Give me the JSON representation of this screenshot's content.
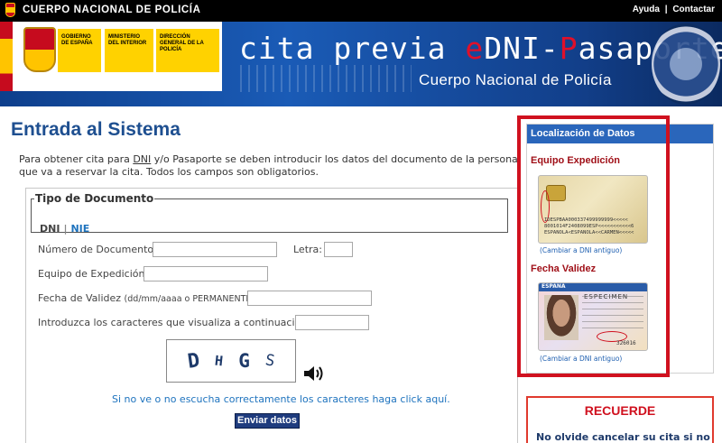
{
  "topbar": {
    "brand": "CUERPO NACIONAL DE POLICÍA",
    "links": [
      "Ayuda",
      "Contactar"
    ],
    "separator": "|"
  },
  "banner": {
    "gov_blocks": [
      "GOBIERNO DE ESPAÑA",
      "MINISTERIO DEL INTERIOR",
      "DIRECCIÓN GENERAL DE LA POLICÍA"
    ],
    "title_part1": "cita previa ",
    "title_e": "e",
    "title_dni": "DNI-",
    "title_p": "P",
    "title_rest": "asaporte",
    "subtitle": "Cuerpo Nacional de Policía"
  },
  "main": {
    "title": "Entrada al Sistema",
    "intro_1": "Para obtener cita para ",
    "intro_dni": "DNI",
    "intro_2": " y/o Pasaporte se deben introducir los datos del documento de la persona que va a reservar la cita. Todos los campos son obligatorios."
  },
  "form": {
    "doc_type_legend": "Tipo de Documento",
    "doc_type_options": [
      "DNI",
      "NIE"
    ],
    "doc_type_sep": "|",
    "doc_number_label": "Número de Documento:",
    "letter_label": "Letra:",
    "team_label": "Equipo de Expedición:",
    "validity_label": "Fecha de Validez",
    "validity_hint": "(dd/mm/aaaa o PERMANENTE):",
    "captcha_label": "Introduzca los caracteres que visualiza a continuación:",
    "captcha_chars": [
      "D",
      "H",
      "G",
      "S"
    ],
    "captcha_help_link": "Si no ve o no escucha correctamente los caracteres haga click aquí.",
    "submit_label": "Enviar datos",
    "doc_number_value": "",
    "letter_value": "",
    "team_value": "",
    "validity_value": "",
    "captcha_value": ""
  },
  "sidebar": {
    "header": "Localización de Datos",
    "section1_title": "Equipo Expedición",
    "section1_link": "(Cambiar a DNI antiguo)",
    "section2_title": "Fecha Validez",
    "section2_link": "(Cambiar a DNI antiguo)",
    "card1_mrz": [
      "IDESPBAA000337499999999<<<<<",
      "8001014F2408099ESP<<<<<<<<<<<6",
      "ESPANOLA<ESPANOLA<<CARMEN<<<<<"
    ],
    "card2_header": "ESPAÑA",
    "card2_specimen": "ESPECIMEN",
    "card2_number": "326016"
  },
  "remember": {
    "title": "RECUERDE",
    "text": "No olvide cancelar su cita si no"
  },
  "colors": {
    "accent_blue": "#1e4f90",
    "link_blue": "#1e73be",
    "highlight_red": "#d0111f"
  }
}
